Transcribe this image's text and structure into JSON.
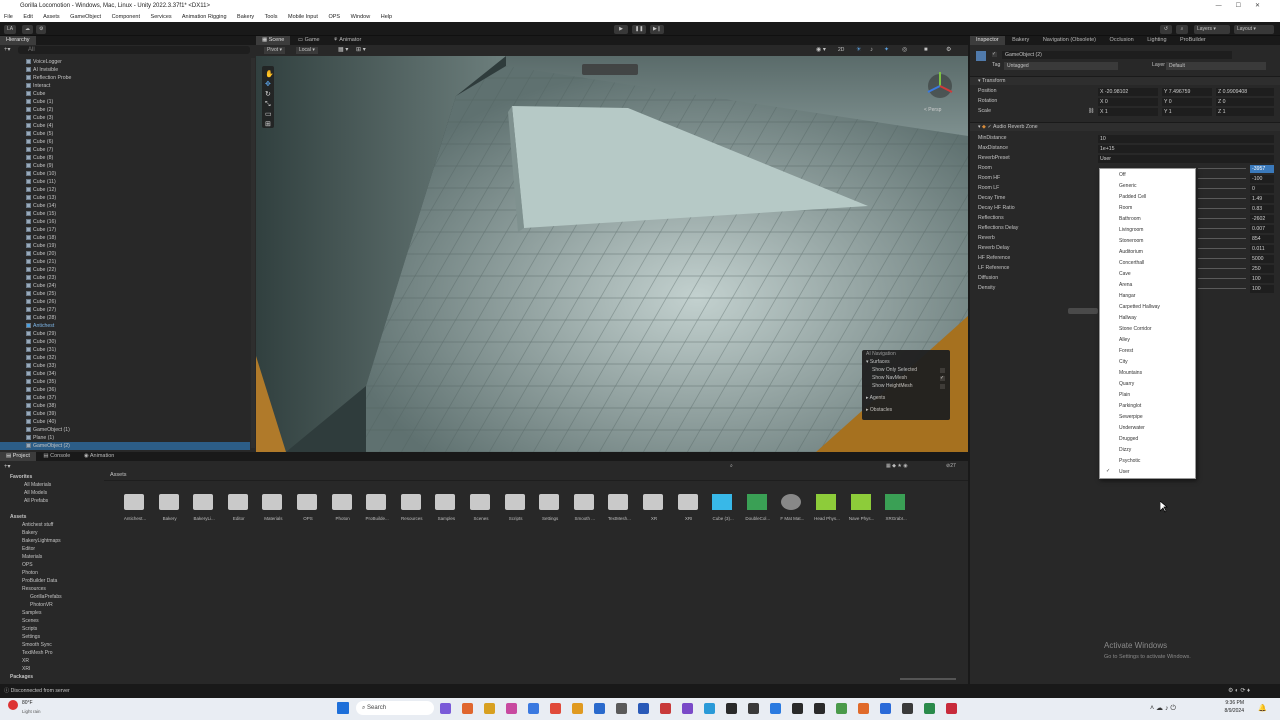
{
  "window": {
    "title": "Gorilla Locomotion - Windows, Mac, Linux - Unity 2022.3.37f1* <DX11>",
    "controls": [
      "—",
      "☐",
      "✕"
    ]
  },
  "menu": [
    "File",
    "Edit",
    "Assets",
    "GameObject",
    "Component",
    "Services",
    "Animation Rigging",
    "Bakery",
    "Tools",
    "Mobile Input",
    "OPS",
    "Window",
    "Help"
  ],
  "toolbar": {
    "account": "LA",
    "layers": "Layers",
    "layout": "Layout"
  },
  "hierarchy": {
    "tab": "Hierarchy",
    "search_placeholder": "All",
    "items": [
      "VoiceLogger",
      "AI Invisible",
      "Reflection Probe",
      "Interact",
      "Cube",
      "Cube (1)",
      "Cube (2)",
      "Cube (3)",
      "Cube (4)",
      "Cube (5)",
      "Cube (6)",
      "Cube (7)",
      "Cube (8)",
      "Cube (9)",
      "Cube (10)",
      "Cube (11)",
      "Cube (12)",
      "Cube (13)",
      "Cube (14)",
      "Cube (15)",
      "Cube (16)",
      "Cube (17)",
      "Cube (18)",
      "Cube (19)",
      "Cube (20)",
      "Cube (21)",
      "Cube (22)",
      "Cube (23)",
      "Cube (24)",
      "Cube (25)",
      "Cube (26)",
      "Cube (27)",
      "Cube (28)",
      "Antichest",
      "Cube (29)",
      "Cube (30)",
      "Cube (31)",
      "Cube (32)",
      "Cube (33)",
      "Cube (34)",
      "Cube (35)",
      "Cube (36)",
      "Cube (37)",
      "Cube (38)",
      "Cube (39)",
      "Cube (40)",
      "GameObject (1)",
      "Plane (1)",
      "GameObject (2)"
    ]
  },
  "scene_tabs": [
    "Scene",
    "Game",
    "Animator"
  ],
  "scene_toolbar": {
    "pivot": "Pivot",
    "local": "Local",
    "view_2d": "2D",
    "persp_label": "< Persp"
  },
  "ai_navigation": {
    "title": "AI Navigation",
    "surfaces": "Surfaces",
    "show_only_selected": "Show Only Selected",
    "show_navmesh": "Show NavMesh",
    "show_heightmesh": "Show HeightMesh",
    "agents": "Agents",
    "obstacles": "Obstacles"
  },
  "inspector": {
    "tabs": [
      "Inspector",
      "Bakery",
      "Navigation (Obsolete)",
      "Occlusion",
      "Lighting",
      "ProBuilder"
    ],
    "object_name": "GameObject (2)",
    "tag_label": "Tag",
    "tag_value": "Untagged",
    "layer_label": "Layer",
    "layer_value": "Default",
    "transform": {
      "title": "Transform",
      "position_label": "Position",
      "rotation_label": "Rotation",
      "scale_label": "Scale",
      "position": [
        "X -20.98102",
        "Y 7.496759",
        "Z 0.9909408"
      ],
      "rotation": [
        "X 0",
        "Y 0",
        "Z 0"
      ],
      "scale": [
        "X 1",
        "Y 1",
        "Z 1"
      ]
    },
    "reverb": {
      "title": "Audio Reverb Zone",
      "rows": [
        {
          "label": "MinDistance",
          "value": "10"
        },
        {
          "label": "MaxDistance",
          "value": "1e+15"
        },
        {
          "label": "ReverbPreset",
          "value": "User"
        },
        {
          "label": "Room",
          "value": "-3957"
        },
        {
          "label": "Room HF",
          "value": "-100"
        },
        {
          "label": "Room LF",
          "value": "0"
        },
        {
          "label": "Decay Time",
          "value": "1.49"
        },
        {
          "label": "Decay HF Ratio",
          "value": "0.83"
        },
        {
          "label": "Reflections",
          "value": "-2602"
        },
        {
          "label": "Reflections Delay",
          "value": "0.007"
        },
        {
          "label": "Reverb",
          "value": "854"
        },
        {
          "label": "Reverb Delay",
          "value": "0.011"
        },
        {
          "label": "HF Reference",
          "value": "5000"
        },
        {
          "label": "LF Reference",
          "value": "250"
        },
        {
          "label": "Diffusion",
          "value": "100"
        },
        {
          "label": "Density",
          "value": "100"
        }
      ]
    }
  },
  "reverb_dropdown": {
    "options": [
      "Off",
      "Generic",
      "Padded Cell",
      "Room",
      "Bathroom",
      "Livingroom",
      "Stoneroom",
      "Auditorium",
      "Concerthall",
      "Cave",
      "Arena",
      "Hangar",
      "Carpetted Hallway",
      "Hallway",
      "Stone Corridor",
      "Alley",
      "Forest",
      "City",
      "Mountains",
      "Quarry",
      "Plain",
      "Parkinglot",
      "Sewerpipe",
      "Underwater",
      "Drugged",
      "Dizzy",
      "Psychotic",
      "User"
    ],
    "selected": "User",
    "check": "✓"
  },
  "project": {
    "tabs": [
      "Project",
      "Console",
      "Animation"
    ],
    "favorites_title": "Favorites",
    "favorites": [
      "All Materials",
      "All Models",
      "All Prefabs"
    ],
    "assets_title": "Assets",
    "tree": [
      "Antichest stuff",
      "Bakery",
      "BakeryLightmaps",
      "Editor",
      "Materials",
      "OPS",
      "Photon",
      "ProBuilder Data",
      "Resources",
      "GorillaPrefabs",
      "PhotonVR",
      "Samples",
      "Scenes",
      "Scripts",
      "Settings",
      "Smooth Sync",
      "TextMesh Pro",
      "XR",
      "XRI"
    ],
    "packages_title": "Packages",
    "breadcrumb": "Assets",
    "items": [
      "Antichest...",
      "Bakery",
      "BakeryLi...",
      "Editor",
      "Materials",
      "OPS",
      "Photon",
      "ProBuilde...",
      "Resources",
      "Samples",
      "Scenes",
      "Scripts",
      "Settings",
      "Smooth ...",
      "TextMesh...",
      "XR",
      "XRI",
      "Cube (3)...",
      "DoubleCol...",
      "F Mat Mat...",
      "Head Phys...",
      "Nave Phys...",
      "XRGrabI..."
    ],
    "count": "27"
  },
  "status": {
    "message": "Disconnected from server"
  },
  "watermark": {
    "title": "Activate Windows",
    "subtitle": "Go to Settings to activate Windows."
  },
  "taskbar": {
    "weather_temp": "80°F",
    "weather_desc": "Light rain",
    "search_placeholder": "Search",
    "time": "9:36 PM",
    "date": "8/9/2024"
  },
  "colors": {
    "accent": "#3a79bb",
    "selection": "#2c5d87",
    "panel": "#282828",
    "scene_floor": "#8aa4a0"
  }
}
